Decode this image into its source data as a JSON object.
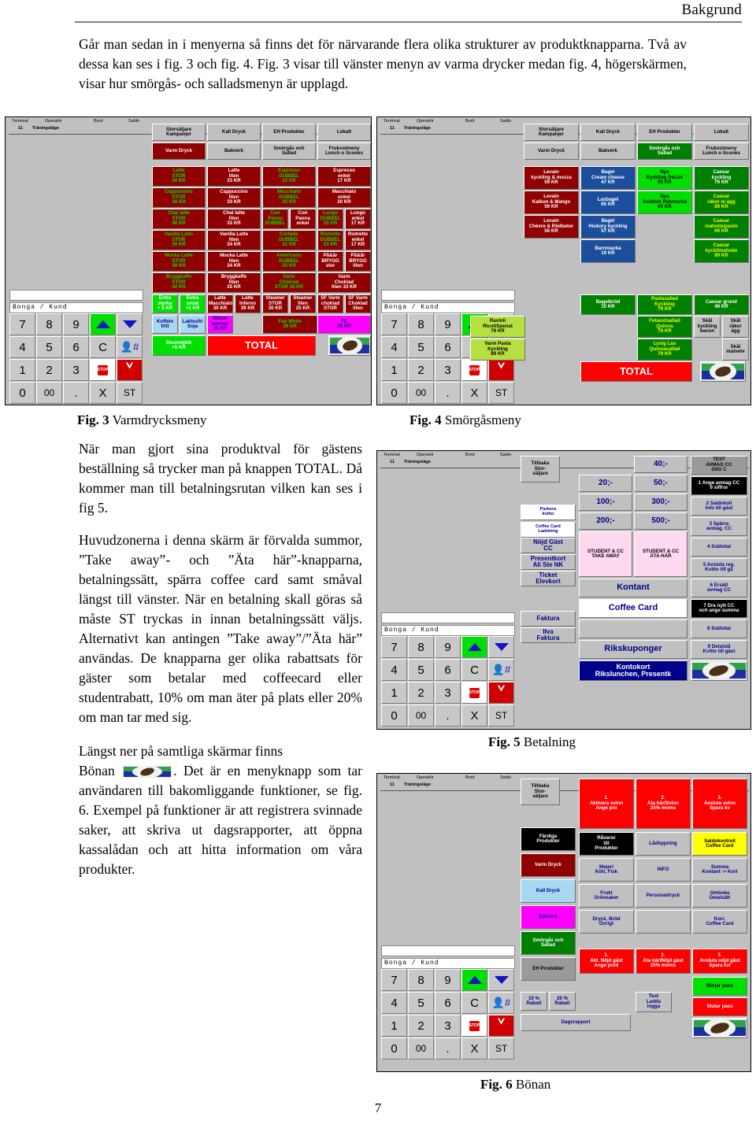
{
  "header": {
    "title": "Bakgrund"
  },
  "intro": "Går man sedan in i menyerna så finns det för närvarande flera olika strukturer av produktknapparna. Två av dessa kan ses i fig. 3 och fig. 4. Fig. 3 visar till vänster menyn av varma drycker medan fig. 4, högerskärmen, visar hur smörgås- och salladsmenyn är upplagd.",
  "body": {
    "p1": "När man gjort sina produktval för gästens beställning så trycker man på knappen TOTAL. Då kommer man till betalningsrutan vilken kan ses i fig 5.",
    "p2": "Huvudzonerna i denna skärm är förvalda summor, ”Take away”- och ”Äta här”-knapparna, betalningssätt, spärra coffee card samt småval längst till vänster. När en betalning skall göras så måste ST tryckas in innan betalningssätt väljs. Alternativt kan antingen ”Take away”/”Äta här” användas. De knapparna ger olika rabattsats för gäster som betalar med coffeecard eller studentrabatt, 10% om man äter på plats eller 20% om man tar med sig.",
    "p3_pre": "Längst ner på samtliga skärmar finns",
    "p3_word": "Bönan",
    "p3_post": ". Det är en menyknapp som tar användaren till bakomliggande funktioner, se fig. 6. Exempel på funktioner är att registrera svinnade saker, att skriva ut dagsrapporter, att öppna kassalådan och att hitta information om våra produkter."
  },
  "captions": {
    "fig3": {
      "num": "Fig. 3",
      "text": "Varmdrycksmeny"
    },
    "fig4": {
      "num": "Fig. 4",
      "text": "Smörgåsmeny"
    },
    "fig5": {
      "num": "Fig. 5",
      "text": "Betalning"
    },
    "fig6": {
      "num": "Fig. 6",
      "text": "Bönan"
    }
  },
  "page_number": "7",
  "pos_common": {
    "status_headers": [
      "Terminal",
      "Operatör",
      "Bord",
      "Saldo"
    ],
    "status_values": [
      "11",
      "Träningsläge"
    ],
    "customer_field": "Bonga / Kund",
    "keypad": [
      "7",
      "8",
      "9",
      "arrow-up",
      "arrow-down",
      "4",
      "5",
      "6",
      "C",
      "person",
      "1",
      "2",
      "3",
      "STOP",
      "S",
      "0",
      "00",
      ".",
      "X",
      "ST"
    ],
    "total_label": "TOTAL",
    "bean_label": "bean-icon"
  },
  "fig3": {
    "tabs_row1": [
      "Storsäljare Kampanjer",
      "Kall Dryck",
      "EH Produkter",
      "Lokalt"
    ],
    "tabs_row2": [
      "Varm Dryck",
      "Bakverk",
      "Smörgås och Sallad",
      "Frukostmeny Lunch o Scones"
    ],
    "products": [
      {
        "l1": "Latte",
        "l2": "STOR",
        "l3": "30 KR"
      },
      {
        "l1": "Latte",
        "l2": "liten",
        "l3": "33 KR"
      },
      {
        "l1": "Espresso",
        "l2": "DUBBEL",
        "l3": "23 KR"
      },
      {
        "l1": "Espresso",
        "l2": "enkel",
        "l3": "17 KR"
      },
      {
        "l1": "Cappuccino",
        "l2": "STOR",
        "l3": "38 KR"
      },
      {
        "l1": "Cappuccino",
        "l2": "liten",
        "l3": "33 KR"
      },
      {
        "l1": "Macchiato",
        "l2": "DUBBEL",
        "l3": "25 KR"
      },
      {
        "l1": "Macchiato",
        "l2": "enkel",
        "l3": "20 KR"
      },
      {
        "l1": "Chai latte",
        "l2": "STOR",
        "l3": "38 KR"
      },
      {
        "l1": "Chai latte",
        "l2": "liten",
        "l3": "33 KR"
      },
      {
        "l1": "Con",
        "l2": "Panna",
        "l3": "DUBBEL"
      },
      {
        "l1": "Con",
        "l2": "Panna",
        "l3": "enkel"
      },
      {
        "l1": "Lungo",
        "l2": "DUBBEL",
        "l3": "23 KR"
      },
      {
        "l1": "Lungo",
        "l2": "enkel",
        "l3": "17 KR"
      },
      {
        "l1": "Vanilla Latte",
        "l2": "STOR",
        "l3": "39 KR"
      },
      {
        "l1": "Vanilla Latte",
        "l2": "liten",
        "l3": "34 KR"
      },
      {
        "l1": "Cortado",
        "l2": "DUBBEL",
        "l3": "31 KR"
      },
      {
        "l1": "Ristretto",
        "l2": "DUBBEL",
        "l3": "23 KR"
      },
      {
        "l1": "Ristretto",
        "l2": "enkel",
        "l3": "17 KR"
      },
      {
        "l1": "Mocka Latte",
        "l2": "STOR",
        "l3": "39 KR"
      },
      {
        "l1": "Mocka Latte",
        "l2": "liten",
        "l3": "34 KR"
      },
      {
        "l1": "Americano",
        "l2": "DUBBEL",
        "l3": "25 KR"
      },
      {
        "l1": "På&år",
        "l2": "BRYGG",
        "l3": "stor"
      },
      {
        "l1": "På&år",
        "l2": "BRYGG",
        "l3": "liten"
      },
      {
        "l1": "Bryggkaffe",
        "l2": "STOR",
        "l3": "30 KR"
      },
      {
        "l1": "Bryggkaffe",
        "l2": "liten",
        "l3": "25 KR"
      },
      {
        "l1": "Varm",
        "l2": "Choklad",
        "l3": "STOR 38 KR"
      },
      {
        "l1": "Varm",
        "l2": "Choklad",
        "l3": "liten 33 KR"
      },
      {
        "l1": "Extra",
        "l2": "styrka",
        "l3": "+ 5 KR"
      },
      {
        "l1": "Extra",
        "l2": "smak",
        "l3": "+1 KR"
      },
      {
        "l1": "Latte",
        "l2": "Macchiato",
        "l3": "30 KR"
      },
      {
        "l1": "Latte",
        "l2": "Inferno",
        "l3": "39 KR"
      },
      {
        "l1": "Steamer",
        "l2": "STOR",
        "l3": "30 KR"
      },
      {
        "l1": "Steamer",
        "l2": "liten",
        "l3": "25 KR"
      },
      {
        "l1": "SF Varm",
        "l2": "choklad",
        "l3": "STOR"
      },
      {
        "l1": "SF Varm",
        "l2": "Choklad",
        "l3": "liten"
      },
      {
        "l1": "Koffein",
        "l2": "fritt",
        "l3": ""
      },
      {
        "l1": "Laktosfri",
        "l2": "Soja",
        "l3": ""
      },
      {
        "l1": "Winter",
        "l2": "warmer",
        "l3": "35 KR"
      },
      {
        "l1": "Flat White",
        "l2": "38 KR",
        "l3": ""
      },
      {
        "l1": "TE",
        "l2": "28 KR",
        "l3": ""
      },
      {
        "l1": "Skummjölk",
        "l2": "+5 KR",
        "l3": ""
      }
    ]
  },
  "fig4": {
    "tabs_row1": [
      "Storsäljare Kampanjer",
      "Kall Dryck",
      "EH Produkter",
      "Lokalt"
    ],
    "tabs_row2": [
      "Varm Dryck",
      "Bakverk",
      "Smörgås och Sallad",
      "Frukostmeny Lunch o Scones"
    ],
    "products": [
      {
        "l1": "Levain",
        "l2": "kyckling & mozza",
        "l3": "59 KR"
      },
      {
        "l1": "Bagel",
        "l2": "Cream cheese",
        "l3": "47 KR"
      },
      {
        "l1": "Nya",
        "l2": "Kyckling DeLux",
        "l3": "65 KR"
      },
      {
        "l1": "Caesar",
        "l2": "kyckling",
        "l3": "79 KR"
      },
      {
        "l1": "Levain",
        "l2": "Kalkon & Mango",
        "l3": "59 KR"
      },
      {
        "l1": "Laxbagel",
        "l2": "65 KR",
        "l3": ""
      },
      {
        "l1": "Nya",
        "l2": "Asiatisk Räkmacka",
        "l3": "65 KR"
      },
      {
        "l1": "Caesar",
        "l2": "räkor m ägg",
        "l3": "89 KR"
      },
      {
        "l1": "Levain",
        "l2": "Chèvre & Rödbetor",
        "l3": "59 KR"
      },
      {
        "l1": "Bagel",
        "l2": "Hickory kyckling",
        "l3": "57 KR"
      },
      {
        "l1": "Caesar",
        "l2": "matvete/pesto",
        "l3": "69 KR"
      },
      {
        "l1": "Barnmacka",
        "l2": "19 KR",
        "l3": ""
      },
      {
        "l1": "Caesar",
        "l2": "kyckl/matvete",
        "l3": "89 KR"
      },
      {
        "l1": "Bagelbröd",
        "l2": "15 KR",
        "l3": ""
      },
      {
        "l1": "Pastasallad",
        "l2": "Kyckling",
        "l3": "79 KR"
      },
      {
        "l1": "Caesar grund",
        "l2": "49 KR",
        "l3": ""
      },
      {
        "l1": "Ravioli",
        "l2": "Ricot/Spenat",
        "l3": "79 KR"
      },
      {
        "l1": "Fetaostsallad",
        "l2": "Quinoa",
        "l3": "79 KR"
      },
      {
        "l1": "Skål",
        "l2": "kyckling",
        "l3": "bacon"
      },
      {
        "l1": "Skål",
        "l2": "räkor",
        "l3": "ägg"
      },
      {
        "l1": "Varm Pasta",
        "l2": "Kyckling",
        "l3": "89 KR"
      },
      {
        "l1": "Lyxig Lax",
        "l2": "Quinoasallad",
        "l3": "79 KR"
      },
      {
        "l1": "Skål",
        "l2": "matvete",
        "l3": ""
      }
    ]
  },
  "fig5": {
    "back_button": "Tillbaka Stor- säljare",
    "left_column": [
      "Parkera kvitto",
      "Coffee Card Laddning",
      "Nöjd Gäst CC",
      "Presentkort Ali Ste NK",
      "Ticket Elevkort",
      "Faktura",
      "Ilva Faktura"
    ],
    "amounts": [
      "40;-",
      "20;-",
      "50;-",
      "100;-",
      "300;-",
      "200;-",
      "500;-"
    ],
    "student_buttons": [
      "STUDENT & CC TAKE AWAY",
      "STUDENT & CC ÄTA HÄR"
    ],
    "pay_buttons": [
      "Kontant",
      "Coffee Card",
      "Rikskuponger",
      "Kontokort Rikslunchen, Presentk"
    ],
    "right_column": [
      "TEST AVMAG CC GIIG C",
      "1 Ange avmag CC 9 siffror",
      "2 Saldokoll Info till gäst",
      "3 Spärra avmag. CC",
      "4 Subtotal",
      "5 Avsluta reg. Kvitto till gä",
      "6 Ersätt avmag CC",
      "7 Dra nytt CC och ange summa",
      "8 Subtotal",
      "9 Detalslå Kvitto till gäst"
    ]
  },
  "fig6": {
    "back_button": "Tillbaka Stor- säljare",
    "left_column": [
      "Färdiga Produkter",
      "Varm Dryck",
      "Kall Dryck",
      "Bakverk",
      "Smörgås och Sallad",
      "EH Produkter"
    ],
    "discount_buttons": [
      "10 % Rabatt",
      "20 % Rabatt"
    ],
    "svinn_row": [
      "1. Aktivera svinn Ange pro",
      "2. Äta här/Svinn 25% moms",
      "3. Avsluta svinn Spara kv"
    ],
    "grid": [
      "Råvaror till Produkter",
      "Lådöppning",
      "Saldokontroll Coffee Card",
      "Mejeri Kött, Fisk",
      "INFO",
      "Summa Kontant -> Kort",
      "Frukt Grönsaker",
      "Personaldryck",
      "Omboka Detalsätt",
      "Dryck, Bröd Övrigt",
      "",
      "Korr. Coffee Card"
    ],
    "nojd_row": [
      "1. Akt. Nöjd gäst Ange prod",
      "2. Äta här/Nöjd gäst 25% moms",
      "3. Avsluta nöjd gäst Spara kvi"
    ],
    "pass_buttons": [
      "Börjar pass",
      "Slutar pass"
    ],
    "test_button": "Test Ladda logga",
    "dagsrapport": "Dagsrapport"
  }
}
